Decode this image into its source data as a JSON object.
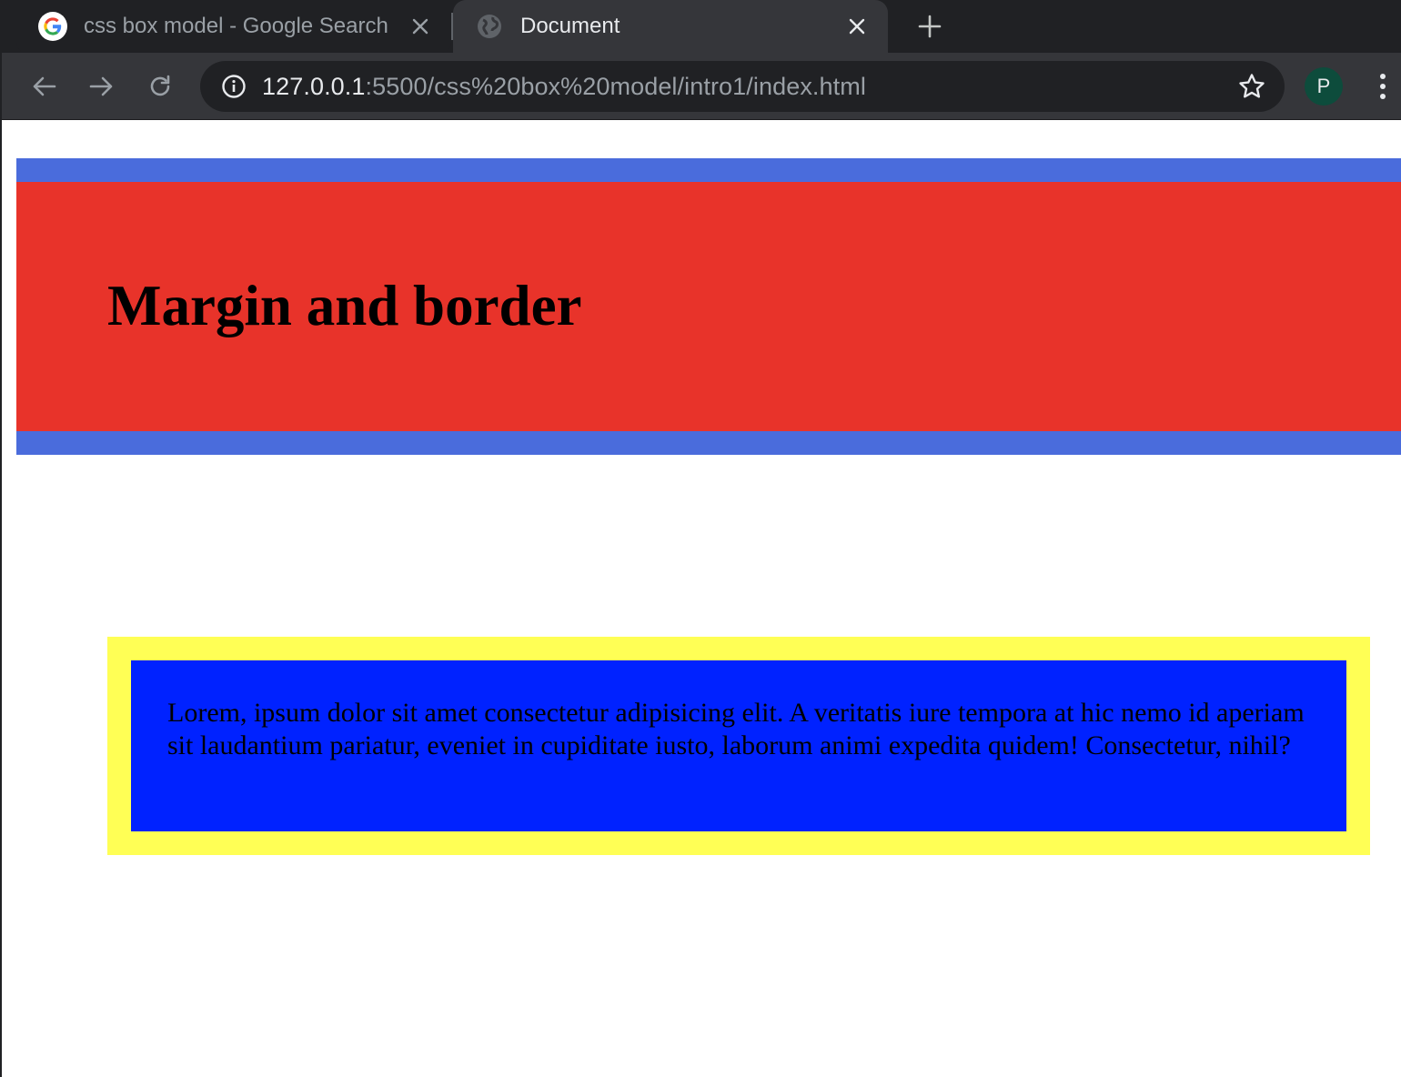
{
  "tabs": [
    {
      "title": "css box model - Google Search",
      "favicon": "google-g-icon",
      "active": false
    },
    {
      "title": "Document",
      "favicon": "globe-icon",
      "active": true
    }
  ],
  "toolbar": {
    "url_host": "127.0.0.1",
    "url_rest": ":5500/css%20box%20model/intro1/index.html",
    "profile_initial": "P"
  },
  "page": {
    "heading": "Margin and border",
    "paragraph": "Lorem, ipsum dolor sit amet consectetur adipisicing elit. A veritatis iure tempora at hic nemo id aperiam sit laudantium pariatur, eveniet in cupiditate iusto, laborum animi expedita quidem! Consectetur, nihil?"
  },
  "colors": {
    "chrome_dark": "#202124",
    "chrome_toolbar": "#35363a",
    "header_background": "#e8332a",
    "header_border": "#4a6cdc",
    "paragraph_background": "#0022ff",
    "paragraph_border": "#ffff55",
    "avatar": "#0d4c3c"
  }
}
